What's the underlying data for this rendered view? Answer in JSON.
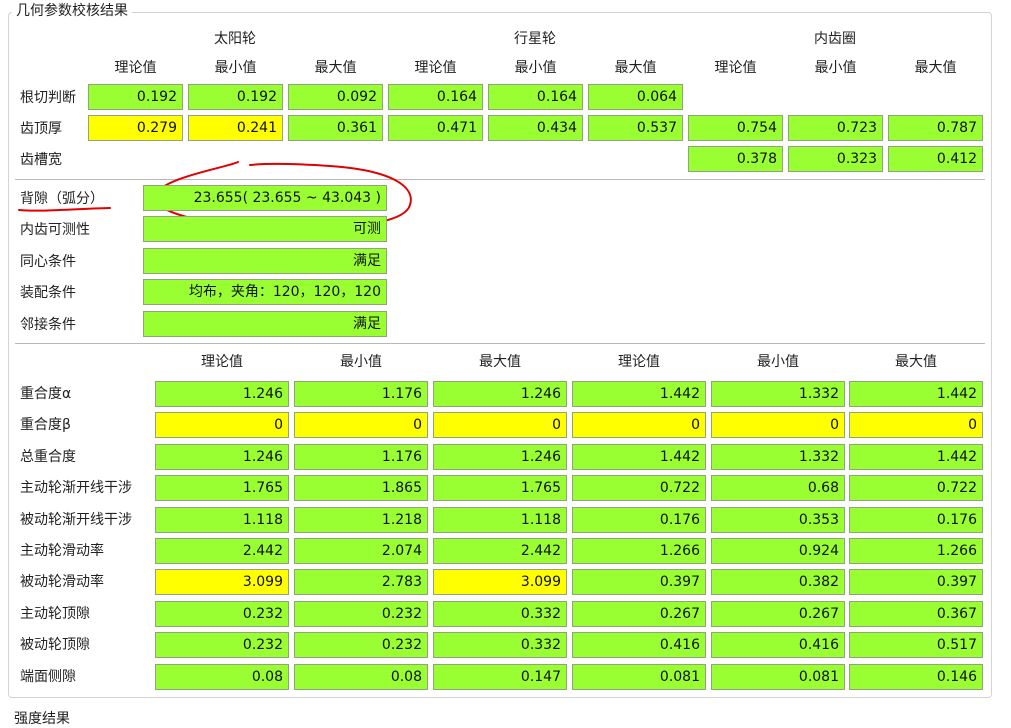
{
  "section_title": "几何参数校核结果",
  "footer_title": "强度结果",
  "top": {
    "group_headers": [
      "太阳轮",
      "行星轮",
      "内齿圈"
    ],
    "col_headers": [
      "理论值",
      "最小值",
      "最大值",
      "理论值",
      "最小值",
      "最大值",
      "理论值",
      "最小值",
      "最大值"
    ],
    "row_labels": [
      "根切判断",
      "齿顶厚",
      "齿槽宽"
    ],
    "root_cut": [
      "0.192",
      "0.192",
      "0.092",
      "0.164",
      "0.164",
      "0.064"
    ],
    "tip_thickness": [
      "0.279",
      "0.241",
      "0.361",
      "0.471",
      "0.434",
      "0.537",
      "0.754",
      "0.723",
      "0.787"
    ],
    "slot_width": [
      "0.378",
      "0.323",
      "0.412"
    ]
  },
  "middle": {
    "labels": [
      "背隙（弧分）",
      "内齿可测性",
      "同心条件",
      "装配条件",
      "邻接条件"
    ],
    "values": [
      "23.655( 23.655 ~ 43.043 )",
      "可测",
      "满足",
      "均布，夹角：120，120，120",
      "满足"
    ]
  },
  "bottom": {
    "col_headers": [
      "理论值",
      "最小值",
      "最大值",
      "理论值",
      "最小值",
      "最大值"
    ],
    "rows": [
      {
        "label": "重合度α",
        "values": [
          "1.246",
          "1.176",
          "1.246",
          "1.442",
          "1.332",
          "1.442"
        ]
      },
      {
        "label": "重合度β",
        "values": [
          "0",
          "0",
          "0",
          "0",
          "0",
          "0"
        ]
      },
      {
        "label": "总重合度",
        "values": [
          "1.246",
          "1.176",
          "1.246",
          "1.442",
          "1.332",
          "1.442"
        ]
      },
      {
        "label": "主动轮渐开线干涉",
        "values": [
          "1.765",
          "1.865",
          "1.765",
          "0.722",
          "0.68",
          "0.722"
        ]
      },
      {
        "label": "被动轮渐开线干涉",
        "values": [
          "1.118",
          "1.218",
          "1.118",
          "0.176",
          "0.353",
          "0.176"
        ]
      },
      {
        "label": "主动轮滑动率",
        "values": [
          "2.442",
          "2.074",
          "2.442",
          "1.266",
          "0.924",
          "1.266"
        ]
      },
      {
        "label": "被动轮滑动率",
        "values": [
          "3.099",
          "2.783",
          "3.099",
          "0.397",
          "0.382",
          "0.397"
        ]
      },
      {
        "label": "主动轮顶隙",
        "values": [
          "0.232",
          "0.232",
          "0.332",
          "0.267",
          "0.267",
          "0.367"
        ]
      },
      {
        "label": "被动轮顶隙",
        "values": [
          "0.232",
          "0.232",
          "0.332",
          "0.416",
          "0.416",
          "0.517"
        ]
      },
      {
        "label": "端面侧隙",
        "values": [
          "0.08",
          "0.08",
          "0.147",
          "0.081",
          "0.081",
          "0.146"
        ]
      }
    ]
  },
  "colors": {
    "ok": "#99ff33",
    "warn": "#ffff00",
    "annotation": "#e00000"
  }
}
